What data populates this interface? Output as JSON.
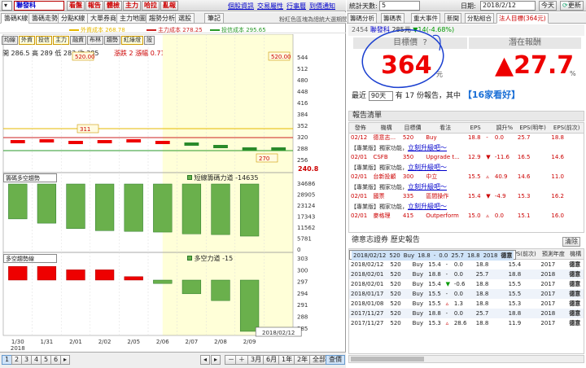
{
  "left": {
    "stock_select": "聯發科",
    "toolbar_buttons": [
      "看盤",
      "報告",
      "體檢",
      "主力",
      "哈拉",
      "亂報"
    ],
    "top_links": [
      "個股資訊",
      "交易屬性",
      "行事曆",
      "到價通知"
    ],
    "tabs": [
      "籌碼K線",
      "籌碼走勢",
      "分點K線",
      "大單券商",
      "主力地圖",
      "趨勢分析",
      "選股",
      "筆記"
    ],
    "note": "粉紅色區塊為總統大選期間",
    "cost_legend": [
      {
        "label": "外資成本 268.78",
        "color": "#e6b800"
      },
      {
        "label": "主力成本 278.25",
        "color": "#cc2222"
      },
      {
        "label": "投信成本 295.65",
        "color": "#2a9a2a"
      }
    ],
    "indicator_buttons": [
      "均線",
      "外資",
      "投信",
      "主力",
      "融資",
      "布林",
      "趨勢",
      "紅綠燈",
      "設"
    ],
    "ohlc": "開 286.5  高 289  低 283  收 285",
    "change": "漲跌 2  漲幅 0.71%  量 5,525",
    "price_flags": [
      "520.00",
      "520.00",
      "311",
      "270"
    ],
    "price_axis": [
      "544",
      "512",
      "480",
      "448",
      "416",
      "384",
      "352",
      "320",
      "288",
      "256"
    ],
    "price_last": "240.8",
    "chip_select": "籌碼多空趨勢",
    "chip_title": "短線籌碼力道 -14635",
    "chip_axis": [
      "34686",
      "28905",
      "23124",
      "17343",
      "11562",
      "5781",
      "0"
    ],
    "chip_values": [
      -9800,
      -11000,
      -12500,
      -13100,
      -13300,
      -13500,
      -14000,
      -14200,
      -14635
    ],
    "ls_select": "多空趨勢線",
    "ls_title": "多空力道 -15",
    "ls_axis": [
      "303",
      "300",
      "297",
      "294",
      "291",
      "288",
      "285"
    ],
    "ls_values": [
      4,
      4,
      3,
      3,
      1,
      -1,
      -4,
      -6,
      -15
    ],
    "x_dates": [
      "1/30",
      "1/31",
      "2/01",
      "2/02",
      "2/05",
      "2/06",
      "2/07",
      "2/08",
      "2/09",
      "2018/02/12"
    ],
    "x_year": "2018",
    "pages": [
      "1",
      "2",
      "3",
      "4",
      "5",
      "6"
    ],
    "period_buttons": [
      "3月",
      "6月",
      "1年",
      "2年",
      "全部",
      "查價"
    ]
  },
  "right": {
    "stat_days_label": "統計天數:",
    "stat_days_value": "5",
    "date_label": "日期:",
    "date_value": "2018/2/12",
    "today_label": "今天",
    "refresh_label": "更新",
    "tabs": [
      "籌碼分析",
      "籌碼表",
      "重大事件",
      "新聞",
      "分點組合",
      "法人目標(364元)"
    ],
    "stock_code": "2454",
    "stock_name": "聯發科",
    "stock_price": "285元",
    "stock_change": "▼14(-4.68%)",
    "target_label": "目標價",
    "target_help": "?",
    "target_value": "364",
    "target_unit": "元",
    "upside_label": "潛在報酬",
    "upside_value": "▲27.7",
    "upside_unit": "%",
    "recent_label": "最近",
    "recent_days": "90天",
    "recent_mid": "有",
    "recent_count": "17",
    "recent_tail": "份報告，其中",
    "bullish": "【16家看好】",
    "report_header": "報告清單",
    "report_cols": [
      "發佈",
      "機構",
      "目標價",
      "看法",
      "EPS",
      "",
      "調升%",
      "EPS(明年)",
      "EPS(前次)"
    ],
    "report_rows": [
      {
        "date": "02/12",
        "inst": "德意志...",
        "target": "520",
        "view": "Buy",
        "eps": "18.8",
        "arrow": "-",
        "chg": "0.0",
        "next": "25.7",
        "prev": "18.8",
        "vip": "【專業版】獨家功能，",
        "link": "立刻升級吧～"
      },
      {
        "date": "02/01",
        "inst": "CSFB",
        "target": "350",
        "view": "Upgrade t...",
        "eps": "12.9",
        "arrow": "▼",
        "chg": "-11.6",
        "next": "16.5",
        "prev": "14.6",
        "vip": "【專業版】獨家功能，",
        "link": "立刻升級吧～"
      },
      {
        "date": "02/01",
        "inst": "台新投顧",
        "target": "300",
        "view": "中立",
        "eps": "15.5",
        "arrow": "▵",
        "chg": "40.9",
        "next": "14.6",
        "prev": "11.0",
        "vip": "【專業版】獨家功能，",
        "link": "立刻升級吧～"
      },
      {
        "date": "02/01",
        "inst": "國票",
        "target": "335",
        "view": "區間操作",
        "eps": "15.4",
        "arrow": "▼",
        "chg": "-4.9",
        "next": "15.3",
        "prev": "16.2",
        "vip": "【專業版】獨家功能，",
        "link": "立刻升級吧～"
      },
      {
        "date": "02/01",
        "inst": "麥格理",
        "target": "415",
        "view": "Outperform",
        "eps": "15.0",
        "arrow": "▵",
        "chg": "0.0",
        "next": "15.1",
        "prev": "16.0",
        "vip": "",
        "link": ""
      }
    ],
    "history_header": "德意志證券 歷史報告",
    "clear_label": "清除",
    "history_cols": [
      "發佈",
      "目標價",
      "看法",
      "EPS",
      "",
      "調升%",
      "EPS(明年)",
      "EPS(前次)",
      "預測年度",
      "機構"
    ],
    "history_rows": [
      [
        "2018/02/12",
        "520",
        "Buy",
        "18.8",
        "-",
        "0.0",
        "25.7",
        "18.8",
        "2018",
        "德意"
      ],
      [
        "2018/02/12",
        "520",
        "Buy",
        "15.4",
        "-",
        "0.0",
        "18.8",
        "15.4",
        "2017",
        "德意"
      ],
      [
        "2018/02/01",
        "520",
        "Buy",
        "18.8",
        "-",
        "0.0",
        "25.7",
        "18.8",
        "2018",
        "德意"
      ],
      [
        "2018/02/01",
        "520",
        "Buy",
        "15.4",
        "▼",
        "-0.6",
        "18.8",
        "15.5",
        "2017",
        "德意"
      ],
      [
        "2018/01/17",
        "520",
        "Buy",
        "15.5",
        "-",
        "0.0",
        "18.8",
        "15.5",
        "2017",
        "德意"
      ],
      [
        "2018/01/08",
        "520",
        "Buy",
        "15.5",
        "▵",
        "1.3",
        "18.8",
        "15.3",
        "2017",
        "德意"
      ],
      [
        "2017/11/27",
        "520",
        "Buy",
        "18.8",
        "-",
        "0.0",
        "25.7",
        "18.8",
        "2018",
        "德意"
      ],
      [
        "2017/11/27",
        "520",
        "Buy",
        "15.3",
        "▵",
        "28.6",
        "18.8",
        "11.9",
        "2017",
        "德意"
      ]
    ]
  }
}
